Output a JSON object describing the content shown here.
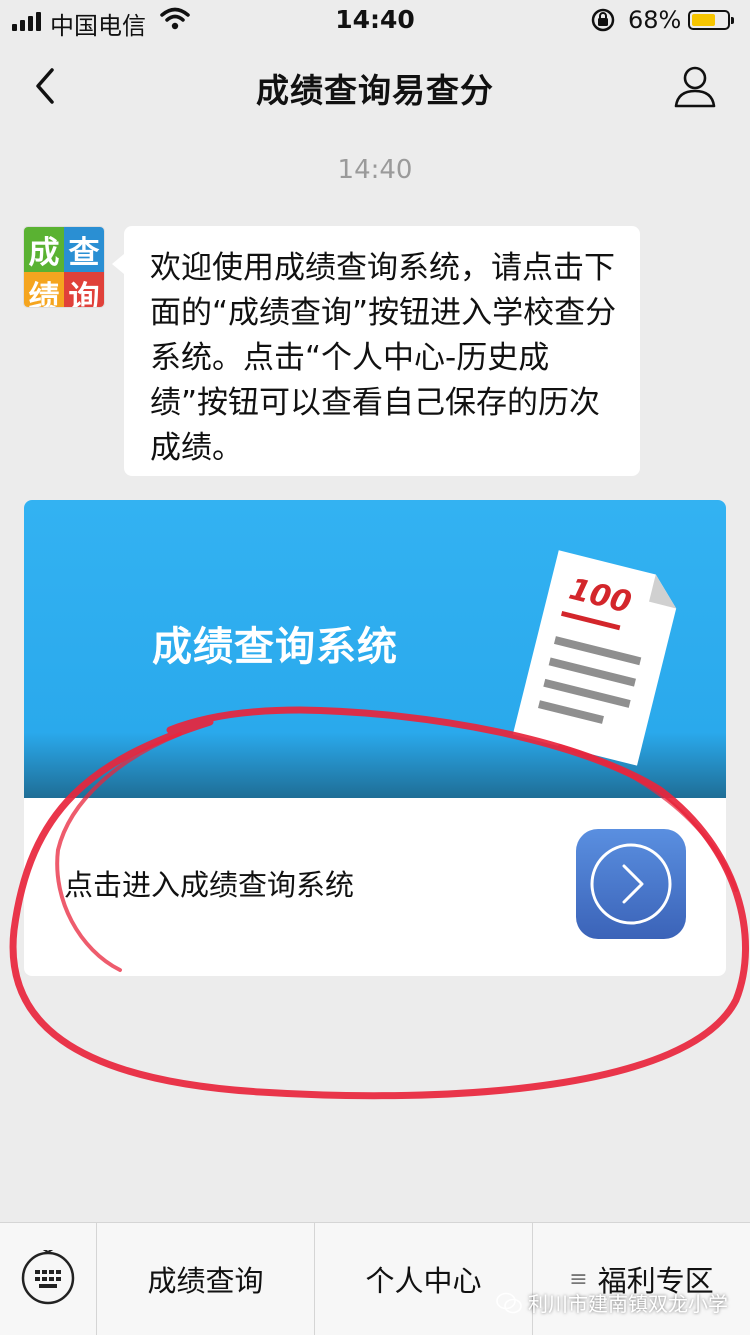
{
  "status_bar": {
    "carrier": "中国电信",
    "time": "14:40",
    "battery_percent": "68%",
    "battery_level": 0.68
  },
  "nav": {
    "title": "成绩查询易查分",
    "back_icon": "chevron-left-icon",
    "profile_icon": "person-icon"
  },
  "chat": {
    "timestamp": "14:40",
    "avatar": {
      "chars": [
        "成",
        "查",
        "绩",
        "询"
      ]
    },
    "message": "欢迎使用成绩查询系统，请点击下面的“成绩查询”按钮进入学校查分系统。点击“个人中心-历史成绩”按钮可以查看自己保存的历次成绩。"
  },
  "card": {
    "banner_title": "成绩查询系统",
    "paper_score": "100",
    "label": "点击进入成绩查询系统",
    "button_icon": "arrow-right-circle-icon",
    "colors": {
      "banner": "#33b2f2",
      "button": "#4a78cc"
    }
  },
  "bottom_menu": {
    "keyboard_icon": "keyboard-icon",
    "items": [
      "成绩查询",
      "个人中心",
      "福利专区"
    ],
    "menu_icon": "list-icon"
  },
  "watermark": "利川市建南镇双龙小学",
  "annotation_color": "#e8253c"
}
